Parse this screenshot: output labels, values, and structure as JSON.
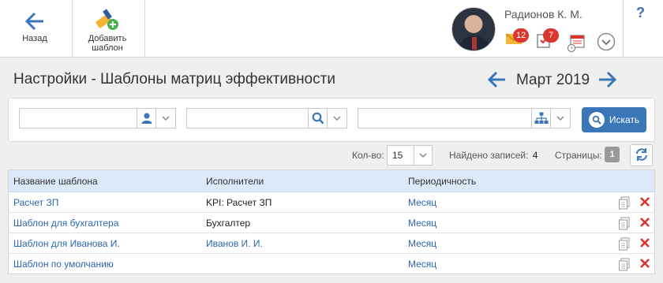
{
  "toolbar": {
    "back_label": "Назад",
    "add_label_line1": "Добавить",
    "add_label_line2": "шаблон"
  },
  "user": {
    "name": "Радионов К. М.",
    "messages_count": "12",
    "tasks_count": "7"
  },
  "help_label": "?",
  "page": {
    "title": "Настройки - Шаблоны матриц эффективности",
    "month": "Март 2019"
  },
  "filters": {
    "field1_value": "",
    "field2_value": "",
    "field3_value": "",
    "search_label": "Искать"
  },
  "pager": {
    "count_label": "Кол-во:",
    "count_value": "15",
    "found_label": "Найдено записей:",
    "found_value": "4",
    "pages_label": "Страницы:",
    "current_page": "1"
  },
  "table": {
    "columns": [
      "Название шаблона",
      "Исполнители",
      "Периодичность"
    ],
    "rows": [
      {
        "name": "Расчет ЗП",
        "executors": "KPI: Расчет ЗП",
        "period": "Месяц"
      },
      {
        "name": "Шаблон для бухгалтера",
        "executors": "Бухгалтер",
        "period": "Месяц"
      },
      {
        "name": "Шаблон для Иванова И.",
        "executors": "Иванов И. И.",
        "period": "Месяц"
      },
      {
        "name": "Шаблон по умолчанию",
        "executors": "",
        "period": "Месяц"
      }
    ]
  },
  "colors": {
    "accent": "#3a76b8",
    "link": "#2b66b0",
    "header_bg": "#dbe9f9",
    "delete": "#d9362f",
    "badge": "#d9362f"
  },
  "icons": [
    "back-arrow-icon",
    "add-template-icon",
    "envelope-icon",
    "tasks-icon",
    "calendar-icon",
    "chevron-down-icon",
    "user-icon",
    "search-icon",
    "org-structure-icon",
    "refresh-icon",
    "copy-icon",
    "delete-icon"
  ]
}
